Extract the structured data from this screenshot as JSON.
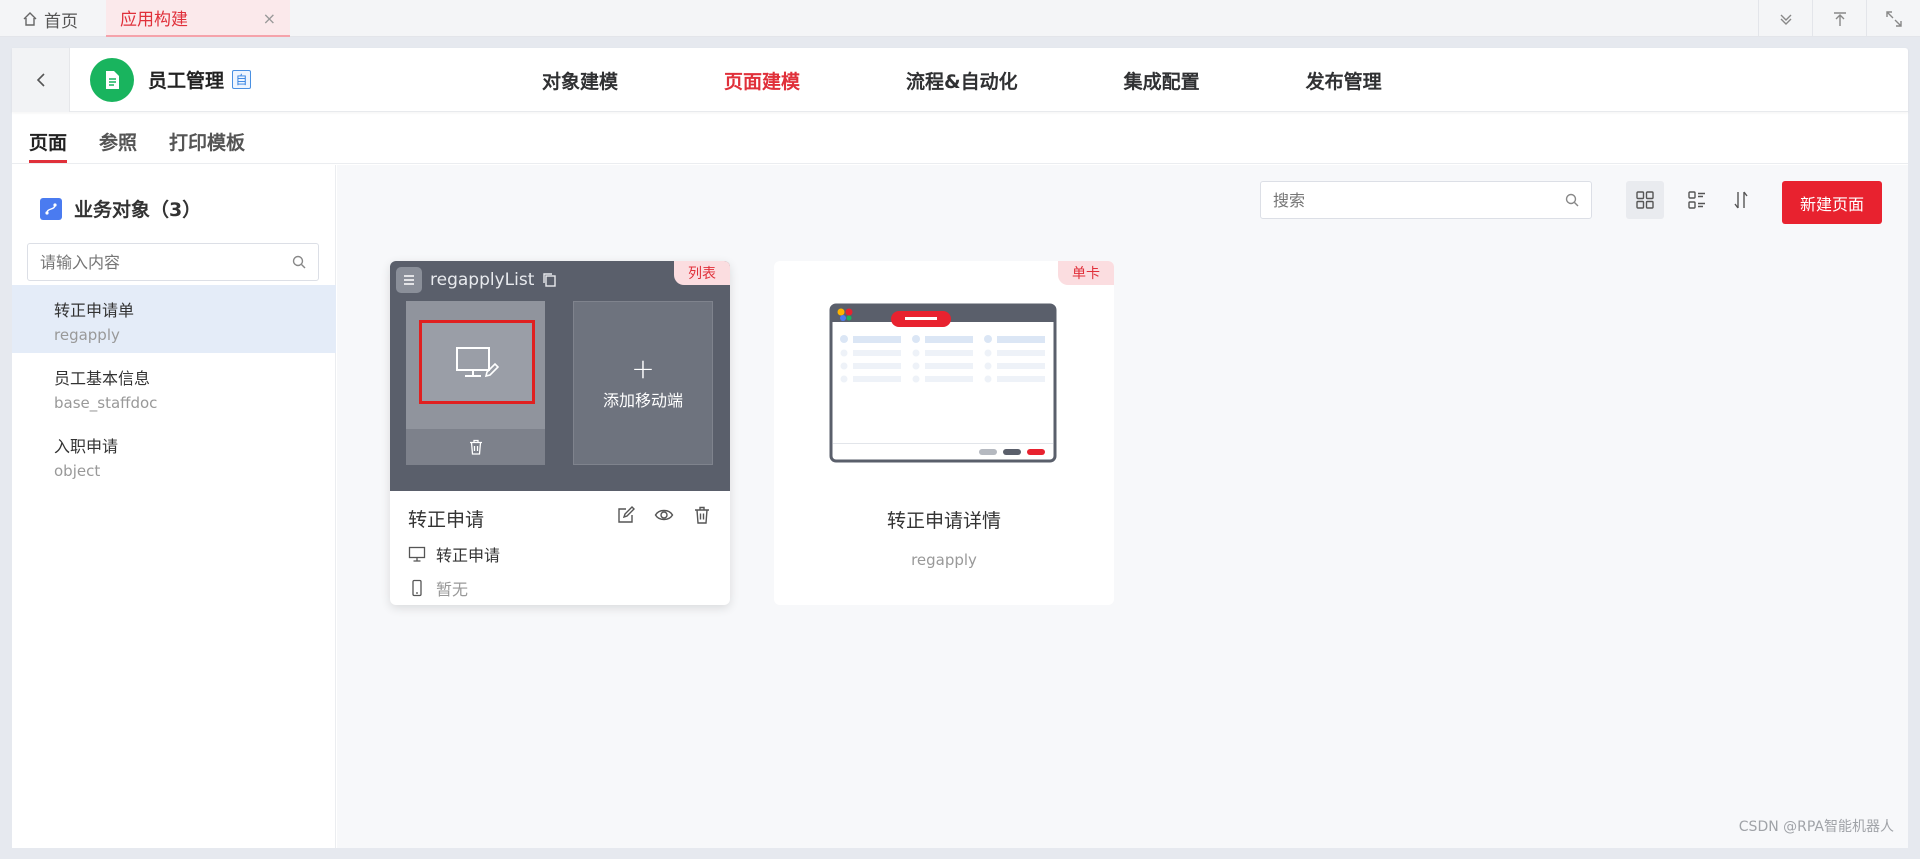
{
  "tabs": {
    "home_label": "首页",
    "active_label": "应用构建",
    "close_glyph": "×"
  },
  "app": {
    "name": "员工管理",
    "badge": "自",
    "logo_color": "#19b45e"
  },
  "main_nav": [
    {
      "label": "对象建模",
      "active": false
    },
    {
      "label": "页面建模",
      "active": true
    },
    {
      "label": "流程&自动化",
      "active": false
    },
    {
      "label": "集成配置",
      "active": false
    },
    {
      "label": "发布管理",
      "active": false
    }
  ],
  "sub_tabs": [
    {
      "label": "页面",
      "active": true
    },
    {
      "label": "参照",
      "active": false
    },
    {
      "label": "打印模板",
      "active": false
    }
  ],
  "sidebar": {
    "title": "业务对象（3）",
    "search_placeholder": "请输入内容",
    "items": [
      {
        "name": "转正申请单",
        "code": "regapply",
        "active": true
      },
      {
        "name": "员工基本信息",
        "code": "base_staffdoc",
        "active": false
      },
      {
        "name": "入职申请",
        "code": "object",
        "active": false
      }
    ]
  },
  "toolbar": {
    "search_placeholder": "搜索",
    "new_button": "新建页面"
  },
  "cards": [
    {
      "tag": "列表",
      "header_name": "regapplyList",
      "add_mobile_label": "添加移动端",
      "title": "转正申请",
      "pc_page": "转正申请",
      "mobile_page": "暂无"
    },
    {
      "tag": "单卡",
      "title": "转正申请详情",
      "code": "regapply"
    }
  ],
  "colors": {
    "accent": "#e0303a",
    "primary_button": "#e8222f"
  },
  "watermark": "CSDN @RPA智能机器人"
}
